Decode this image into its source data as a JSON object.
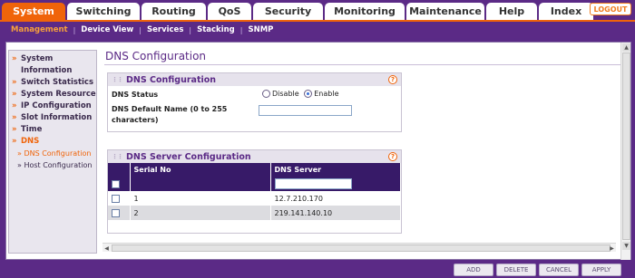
{
  "top_tabs": [
    {
      "label": "System",
      "active": true
    },
    {
      "label": "Switching",
      "active": false
    },
    {
      "label": "Routing",
      "active": false
    },
    {
      "label": "QoS",
      "active": false
    },
    {
      "label": "Security",
      "active": false
    },
    {
      "label": "Monitoring",
      "active": false
    },
    {
      "label": "Maintenance",
      "active": false
    },
    {
      "label": "Help",
      "active": false
    },
    {
      "label": "Index",
      "active": false
    }
  ],
  "logout_label": "LOGOUT",
  "sub_menu": [
    {
      "label": "Management",
      "active": true
    },
    {
      "label": "Device View",
      "active": false
    },
    {
      "label": "Services",
      "active": false
    },
    {
      "label": "Stacking",
      "active": false
    },
    {
      "label": "SNMP",
      "active": false
    }
  ],
  "left_nav": {
    "items": [
      "System Information",
      "Switch Statistics",
      "System Resource",
      "IP Configuration",
      "Slot Information",
      "Time",
      "DNS"
    ],
    "dns_sub": [
      "DNS Configuration",
      "Host Configuration"
    ]
  },
  "page_title": "DNS Configuration",
  "dns_config": {
    "header": "DNS Configuration",
    "status_label": "DNS Status",
    "disable_label": "Disable",
    "enable_label": "Enable",
    "selected": "Enable",
    "default_name_label": "DNS Default Name (0 to 255 characters)",
    "default_name_value": ""
  },
  "dns_server_config": {
    "header": "DNS Server Configuration",
    "columns": [
      "Serial No",
      "DNS Server"
    ],
    "rows": [
      {
        "serial": "1",
        "server": "12.7.210.170"
      },
      {
        "serial": "2",
        "server": "219.141.140.10"
      }
    ],
    "new_server_value": ""
  },
  "buttons": {
    "add": "ADD",
    "delete": "DELETE",
    "cancel": "CANCEL",
    "apply": "APPLY"
  },
  "colors": {
    "brand_purple": "#5b2a86",
    "accent_orange": "#f0640a",
    "table_header": "#371a68"
  }
}
